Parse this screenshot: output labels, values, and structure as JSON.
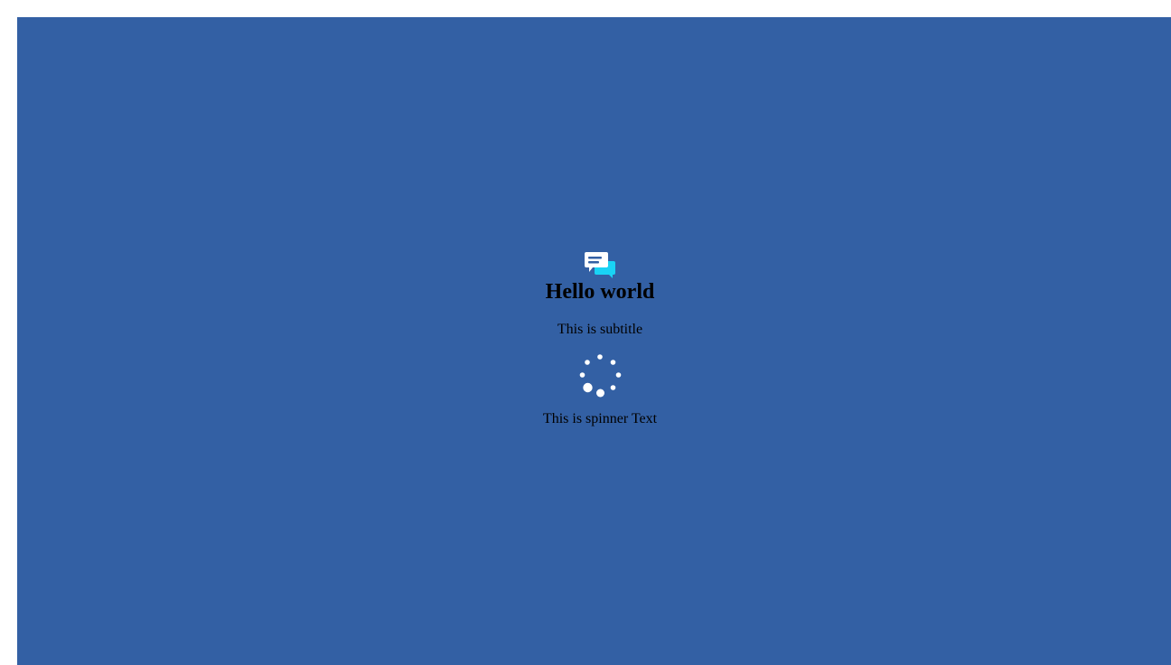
{
  "app": {
    "title": "Hello world",
    "subtitle": "This is subtitle",
    "spinner_text": "This is spinner Text",
    "logo_icon": "chat-bubbles-icon",
    "spinner_icon": "loading-spinner-icon"
  },
  "colors": {
    "background": "#3360a4",
    "frame_border": "#ffffff",
    "bubble_primary": "#ffffff",
    "bubble_secondary": "#19d3f5",
    "text": "#000000"
  }
}
